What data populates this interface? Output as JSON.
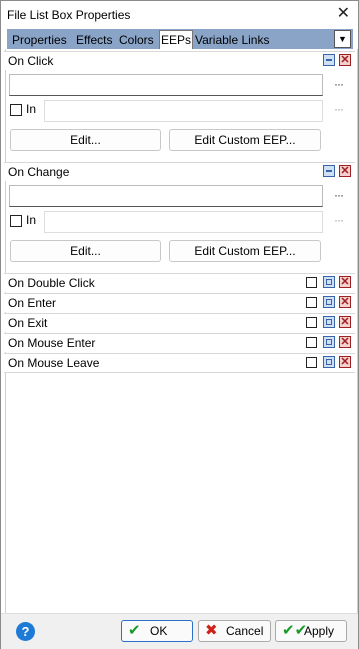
{
  "window": {
    "title": "File List Box Properties"
  },
  "tabs": [
    {
      "label": "Properties"
    },
    {
      "label": "Effects"
    },
    {
      "label": "Colors"
    },
    {
      "label": "EEPs",
      "active": true
    },
    {
      "label": "Variable Links"
    }
  ],
  "sections": {
    "on_click": {
      "label": "On Click",
      "in_label": "In",
      "edit_label": "Edit...",
      "custom_label": "Edit Custom EEP...",
      "more": "···"
    },
    "on_change": {
      "label": "On Change",
      "in_label": "In",
      "edit_label": "Edit...",
      "custom_label": "Edit Custom EEP...",
      "more": "···"
    },
    "collapsed": [
      {
        "label": "On Double Click"
      },
      {
        "label": "On Enter"
      },
      {
        "label": "On Exit"
      },
      {
        "label": "On Mouse Enter"
      },
      {
        "label": "On Mouse Leave"
      }
    ]
  },
  "footer": {
    "help": "?",
    "ok_label": "OK",
    "cancel_label": "Cancel",
    "apply_label": "Apply"
  },
  "colors": {
    "tabbar": "#8aa4c8",
    "accent": "#1e7ad7",
    "close_red": "#a02020"
  }
}
